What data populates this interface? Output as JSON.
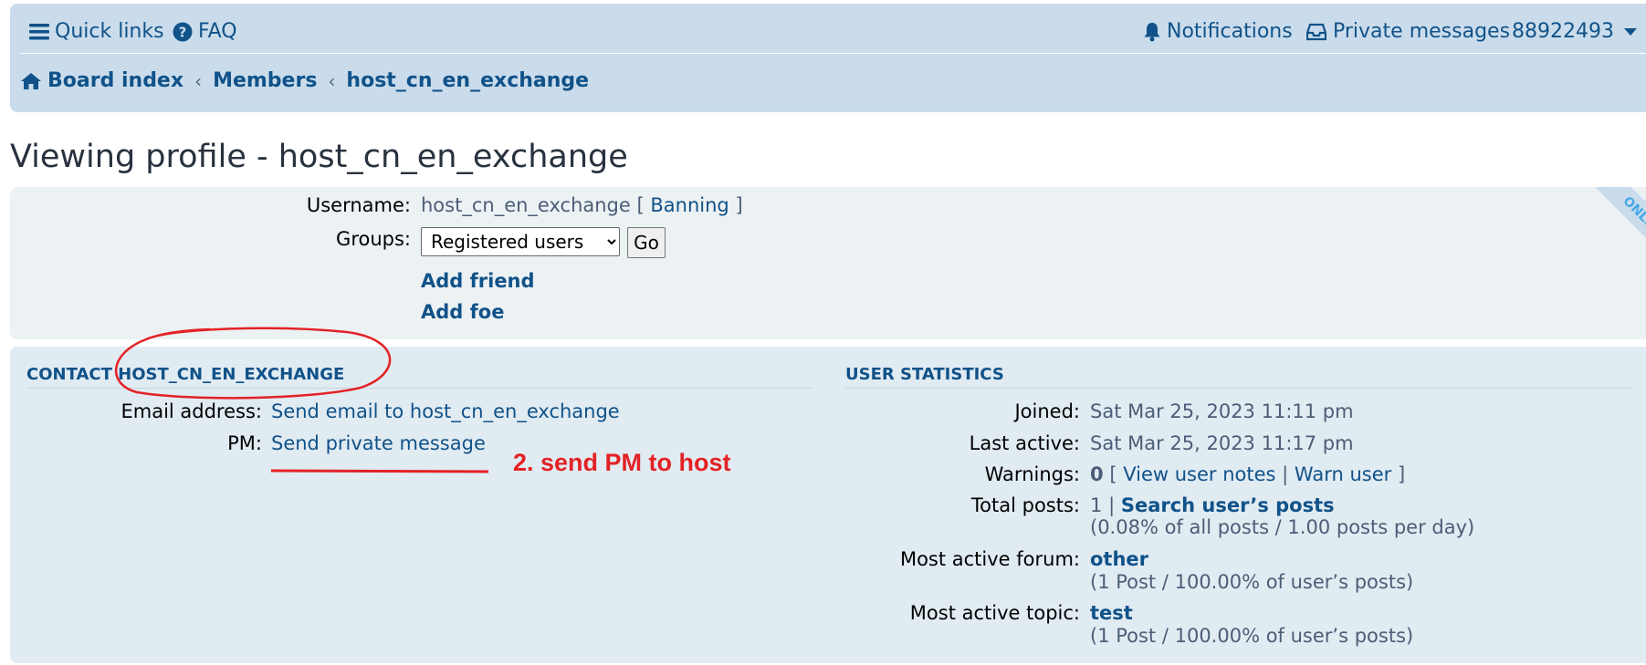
{
  "header": {
    "quick_links": "Quick links",
    "faq": "FAQ",
    "notifications": "Notifications",
    "private_messages": "Private messages",
    "username": "88922493",
    "breadcrumbs": [
      "Board index",
      "Members",
      "host_cn_en_exchange"
    ]
  },
  "page_title": "Viewing profile - host_cn_en_exchange",
  "profile": {
    "username_label": "Username:",
    "username_value": "host_cn_en_exchange",
    "bracket_open": "[",
    "banning": "Banning",
    "bracket_close": "]",
    "groups_label": "Groups:",
    "groups_selected": "Registered users",
    "go_button": "Go",
    "add_friend": "Add friend",
    "add_foe": "Add foe",
    "online_badge": "ONLINE"
  },
  "contact": {
    "heading": "Contact host_cn_en_exchange",
    "email_label": "Email address:",
    "email_link": "Send email to host_cn_en_exchange",
    "pm_label": "PM:",
    "pm_link": "Send private message"
  },
  "stats": {
    "heading": "User statistics",
    "joined_label": "Joined:",
    "joined_value": "Sat Mar 25, 2023 11:11 pm",
    "last_active_label": "Last active:",
    "last_active_value": "Sat Mar 25, 2023 11:17 pm",
    "warnings_label": "Warnings:",
    "warnings_count": "0",
    "warnings_open": "[",
    "view_user_notes": "View user notes",
    "warnings_sep": "|",
    "warn_user": "Warn user",
    "warnings_close": "]",
    "total_posts_label": "Total posts:",
    "total_posts_count": "1",
    "total_posts_sep": "|",
    "search_posts": "Search user’s posts",
    "total_posts_detail": "(0.08% of all posts / 1.00 posts per day)",
    "most_active_forum_label": "Most active forum:",
    "most_active_forum": "other",
    "most_active_forum_detail": "(1 Post / 100.00% of user’s posts)",
    "most_active_topic_label": "Most active topic:",
    "most_active_topic": "test",
    "most_active_topic_detail": "(1 Post / 100.00% of user’s posts)"
  },
  "annotation": {
    "text": "2. send PM to host",
    "color": "#e32225"
  },
  "colors": {
    "header_bg": "#cadceb",
    "link": "#105289",
    "panel_bg": "#e1ebf2",
    "panel_light_bg": "#ecf1f3"
  }
}
